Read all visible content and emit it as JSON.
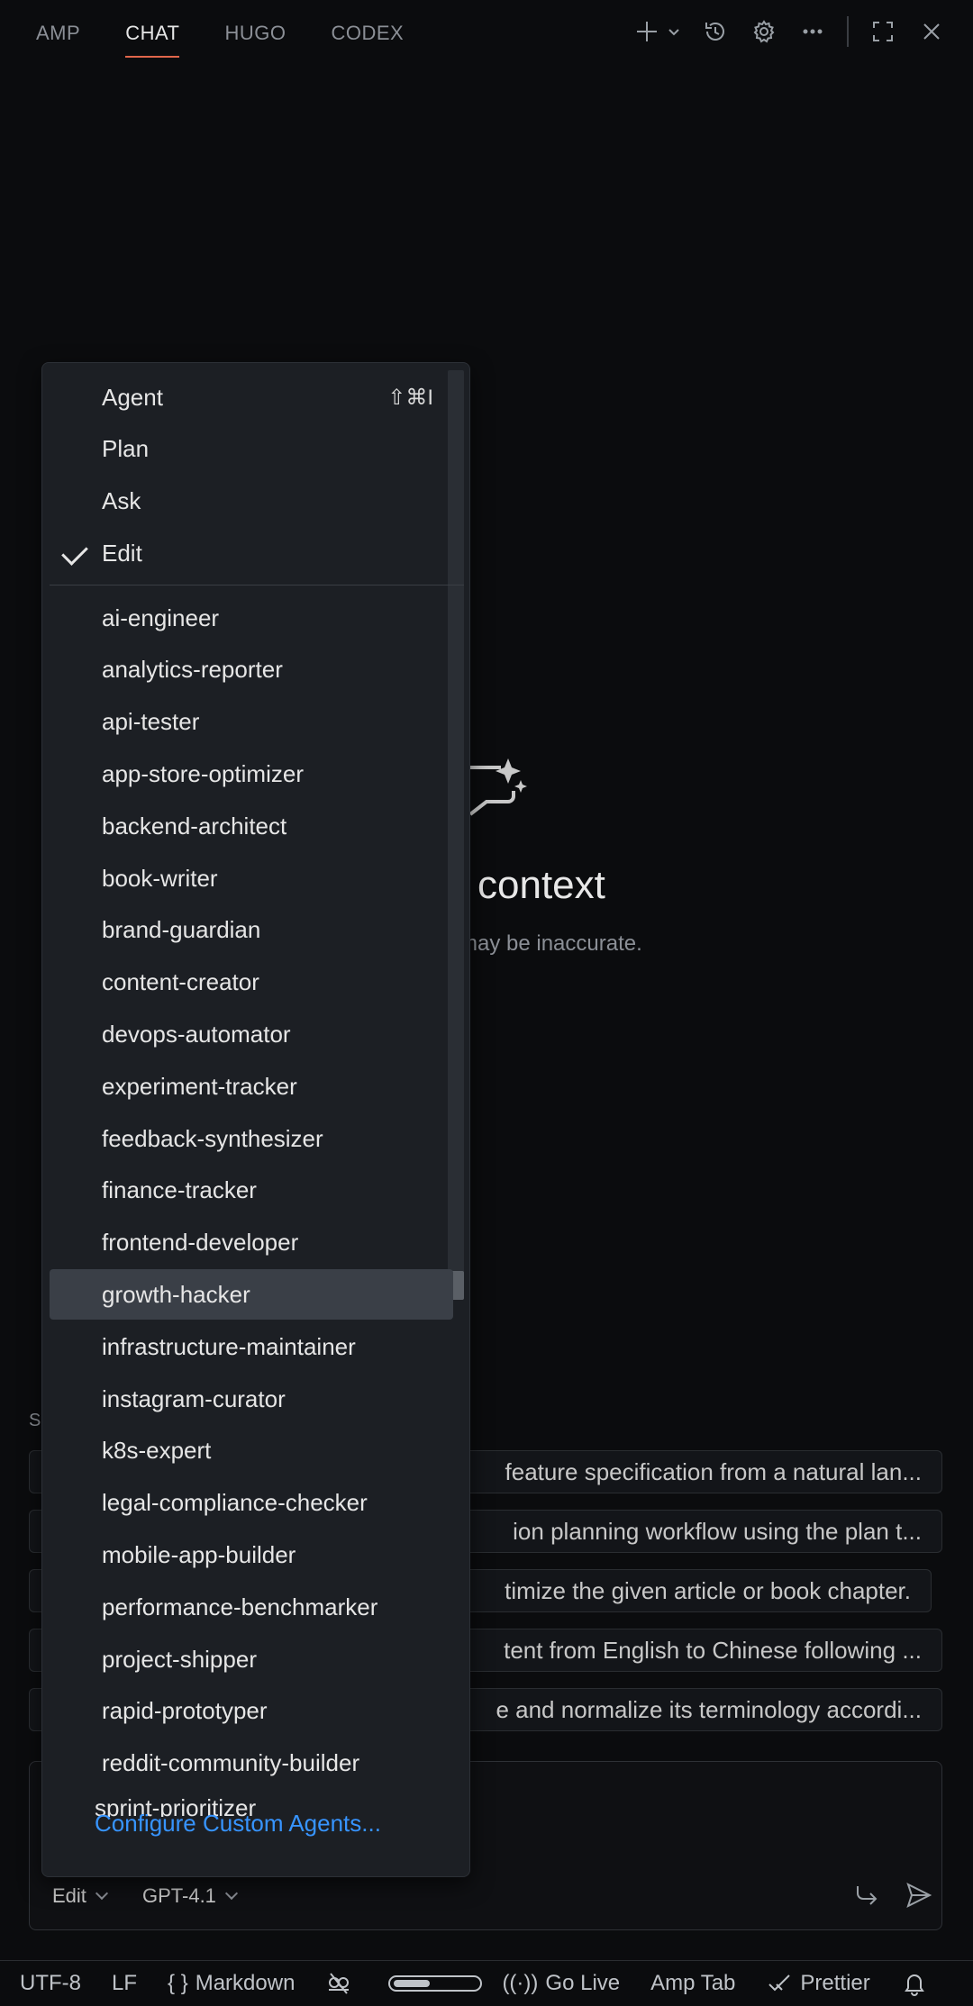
{
  "tabs": [
    {
      "label": "AMP"
    },
    {
      "label": "CHAT",
      "active": true
    },
    {
      "label": "HUGO"
    },
    {
      "label": "CODEX"
    }
  ],
  "welcome": {
    "title": "context",
    "subtitle": "may be inaccurate."
  },
  "suggestions_label": "S",
  "suggestions": [
    "feature specification from a natural lan...",
    "ion planning workflow using the plan t...",
    "timize the given article or book chapter.",
    "tent from English to Chinese following ...",
    "e and normalize its terminology accordi..."
  ],
  "menu": {
    "modes": [
      {
        "label": "Agent",
        "shortcut": "⇧⌘I"
      },
      {
        "label": "Plan"
      },
      {
        "label": "Ask"
      },
      {
        "label": "Edit",
        "checked": true
      }
    ],
    "agents": [
      "ai-engineer",
      "analytics-reporter",
      "api-tester",
      "app-store-optimizer",
      "backend-architect",
      "book-writer",
      "brand-guardian",
      "content-creator",
      "devops-automator",
      "experiment-tracker",
      "feedback-synthesizer",
      "finance-tracker",
      "frontend-developer",
      "growth-hacker",
      "infrastructure-maintainer",
      "instagram-curator",
      "k8s-expert",
      "legal-compliance-checker",
      "mobile-app-builder",
      "performance-benchmarker",
      "project-shipper",
      "rapid-prototyper",
      "reddit-community-builder"
    ],
    "highlighted_agent": "growth-hacker",
    "cutoff_item": "sprint-prioritizer",
    "configure_label": "Configure Custom Agents..."
  },
  "input": {
    "mode": "Edit",
    "model": "GPT-4.1"
  },
  "statusbar": {
    "encoding": "UTF-8",
    "eol": "LF",
    "language": "Markdown",
    "go_live": "Go Live",
    "amp_tab": "Amp Tab",
    "prettier": "Prettier",
    "language_icon": "{ }"
  },
  "colors": {
    "background": "#0b0c0e",
    "menu_bg": "#1c1f24",
    "highlight": "#3a3f47",
    "link": "#3794ff",
    "active_tab_underline": "#e0664b"
  }
}
